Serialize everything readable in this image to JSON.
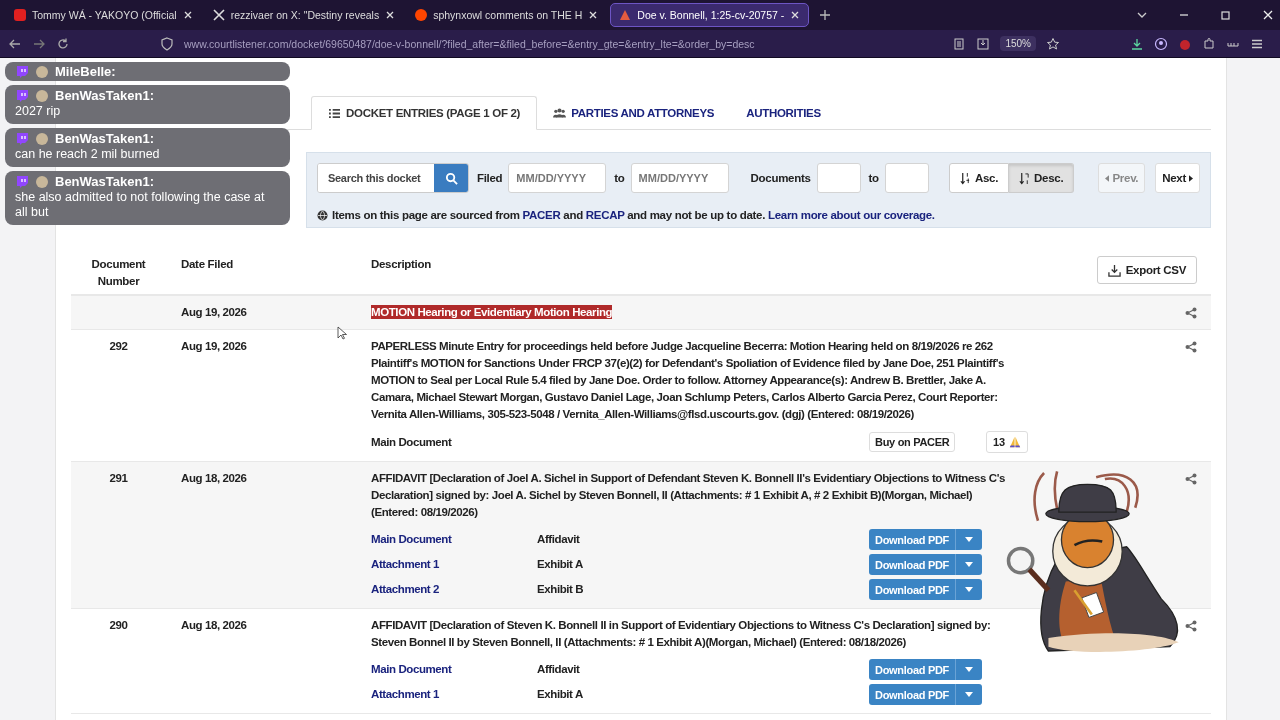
{
  "browser": {
    "tabs": [
      {
        "title": "Tommy WÁ - YAKOYO (Official",
        "selected": false,
        "kind": "video"
      },
      {
        "title": "rezzivaer on X: \"Destiny reveals",
        "selected": false,
        "kind": "x"
      },
      {
        "title": "sphynxowl comments on THE H",
        "selected": false,
        "kind": "forum"
      },
      {
        "title": "Doe v. Bonnell, 1:25-cv-20757 -",
        "selected": true,
        "kind": "court"
      }
    ],
    "url": "www.courtlistener.com/docket/69650487/doe-v-bonnell/?filed_after=&filed_before=&entry_gte=&entry_lte=&order_by=desc",
    "zoom": "150%"
  },
  "chat_overlay": [
    {
      "user": "MileBelle:"
    },
    {
      "user": "BenWasTaken1:",
      "text": "2027 rip"
    },
    {
      "user": "BenWasTaken1:",
      "text": "can he reach 2 mil burned"
    },
    {
      "user": "BenWasTaken1:",
      "text": "she also admitted to not following the case at all but"
    }
  ],
  "docket_tabs": [
    {
      "label": "DOCKET ENTRIES (PAGE 1 OF 2)",
      "selected": true,
      "kind": "list"
    },
    {
      "label": "PARTIES AND ATTORNEYS",
      "selected": false,
      "kind": "people"
    },
    {
      "label": "AUTHORITIES",
      "selected": false,
      "kind": "plain"
    }
  ],
  "filters": {
    "search_placeholder": "Search this docket",
    "filed_label": "Filed",
    "date_from_placeholder": "MM/DD/YYYY",
    "to_label_1": "to",
    "date_to_placeholder": "MM/DD/YYYY",
    "documents_label": "Documents",
    "to_label_2": "to",
    "sort": [
      {
        "label": "Asc.",
        "selected": false,
        "kind": "asc"
      },
      {
        "label": "Desc.",
        "selected": true,
        "kind": "desc"
      }
    ],
    "pager": [
      {
        "label": "Prev.",
        "disabled": true,
        "kind": "prev"
      },
      {
        "label": "Next",
        "disabled": false,
        "kind": "next"
      }
    ]
  },
  "notice": [
    {
      "text": "Items on this page are sourced from ",
      "kind": "text"
    },
    {
      "text": "PACER",
      "kind": "link"
    },
    {
      "text": " and ",
      "kind": "text"
    },
    {
      "text": "RECAP",
      "kind": "link"
    },
    {
      "text": " and may not be up to date. ",
      "kind": "text"
    },
    {
      "text": "Learn more about our coverage.",
      "kind": "link"
    }
  ],
  "table": {
    "columns": [
      "Document Number",
      "Date Filed",
      "Description"
    ],
    "export_button": "Export CSV",
    "rows": [
      {
        "date": "Aug 19, 2026",
        "description": "MOTION Hearing or Evidentiary Motion Hearing",
        "highlighted": true
      },
      {
        "number": "292",
        "date": "Aug 19, 2026",
        "description": "PAPERLESS Minute Entry for proceedings held before Judge Jacqueline Becerra: Motion Hearing held on 8/19/2026 re 262 Plaintiff's MOTION for Sanctions Under FRCP 37(e)(2) for Defendant's Spoliation of Evidence filed by Jane Doe, 251 Plaintiff's MOTION to Seal per Local Rule 5.4 filed by Jane Doe. Order to follow. Attorney Appearance(s): Andrew B. Brettler, Jake A. Camara, Michael Stewart Morgan, Gustavo Daniel Lage, Joan Schlump Peters, Carlos Alberto Garcia Perez, Court Reporter: Vernita Allen-Williams, 305-523-5048 / Vernita_Allen-Williams@flsd.uscourts.gov. (dgj) (Entered: 08/19/2026)",
        "highlighted": false,
        "documents": [
          {
            "label": "Main Document",
            "linked": false,
            "kind": "buy",
            "button": "Buy on PACER",
            "count": "13"
          }
        ]
      },
      {
        "number": "291",
        "date": "Aug 18, 2026",
        "description": "AFFIDAVIT [Declaration of Joel A. Sichel in Support of Defendant Steven K. Bonnell II's Evidentiary Objections to Witness C's Declaration] signed by: Joel A. Sichel by Steven Bonnell, II (Attachments: # 1 Exhibit A, # 2 Exhibit B)(Morgan, Michael) (Entered: 08/19/2026)",
        "highlighted": false,
        "documents": [
          {
            "label": "Main Document",
            "linked": true,
            "type": "Affidavit",
            "kind": "download",
            "button": "Download PDF"
          },
          {
            "label": "Attachment 1",
            "linked": true,
            "type": "Exhibit A",
            "kind": "download",
            "button": "Download PDF"
          },
          {
            "label": "Attachment 2",
            "linked": true,
            "type": "Exhibit B",
            "kind": "download",
            "button": "Download PDF"
          }
        ]
      },
      {
        "number": "290",
        "date": "Aug 18, 2026",
        "description": "AFFIDAVIT [Declaration of Steven K. Bonnell II in Support of Evidentiary Objections to Witness C's Declaration] signed by: Steven Bonnel II by Steven Bonnell, II (Attachments: # 1 Exhibit A)(Morgan, Michael) (Entered: 08/18/2026)",
        "highlighted": false,
        "documents": [
          {
            "label": "Main Document",
            "linked": true,
            "type": "Affidavit",
            "kind": "download",
            "button": "Download PDF"
          },
          {
            "label": "Attachment 1",
            "linked": true,
            "type": "Exhibit A",
            "kind": "download",
            "button": "Download PDF"
          }
        ]
      }
    ]
  }
}
